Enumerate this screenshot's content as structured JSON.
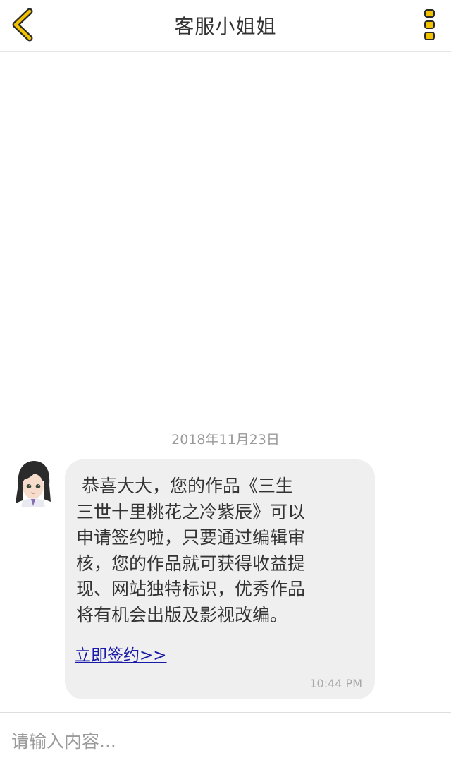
{
  "header": {
    "title": "客服小姐姐",
    "back_icon": "chevron-left-icon",
    "more_icon": "more-vertical-icon",
    "accent_color": "#f2c200"
  },
  "chat": {
    "date": "2018年11月23日",
    "messages": [
      {
        "sender": "客服",
        "avatar": "avatar-anime-girl",
        "text": " 恭喜大大，您的作品《三生\n三世十里桃花之冷紫辰》可以\n申请签约啦，只要通过编辑审\n核，您的作品就可获得收益提\n现、网站独特标识，优秀作品\n将有机会出版及影视改编。",
        "link": "立即签约>> ",
        "time": "10:44 PM"
      }
    ]
  },
  "input": {
    "placeholder": "请输入内容...",
    "value": ""
  }
}
